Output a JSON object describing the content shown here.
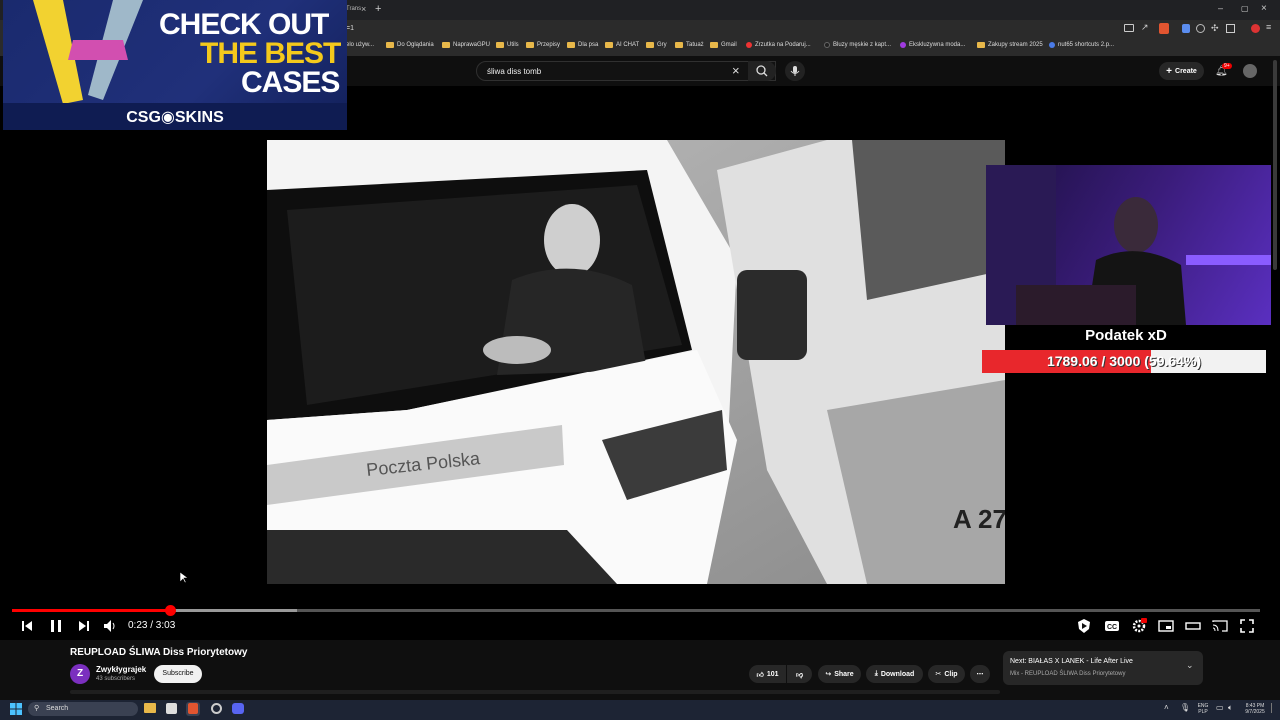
{
  "browser": {
    "tab_partial": "Trans",
    "url_partial": "=1",
    "bookmarks": [
      {
        "label": "elo używ...",
        "kind": "text"
      },
      {
        "label": "Do Oglądania",
        "kind": "folder"
      },
      {
        "label": "NaprawaGPU",
        "kind": "folder"
      },
      {
        "label": "Utils",
        "kind": "folder"
      },
      {
        "label": "Przepisy",
        "kind": "folder"
      },
      {
        "label": "Dla psa",
        "kind": "folder"
      },
      {
        "label": "AI CHAT",
        "kind": "folder"
      },
      {
        "label": "Gry",
        "kind": "folder"
      },
      {
        "label": "Tatuaż",
        "kind": "folder"
      },
      {
        "label": "Gmail",
        "kind": "folder"
      },
      {
        "label": "Zrzutka na Podaruj...",
        "kind": "site"
      },
      {
        "label": "Bluzy męskie z kapt...",
        "kind": "site"
      },
      {
        "label": "Ekskluzywna moda...",
        "kind": "site"
      },
      {
        "label": "Zakupy stream 2025",
        "kind": "folder"
      },
      {
        "label": "nut65 shortcuts 2.p...",
        "kind": "site"
      }
    ]
  },
  "youtube": {
    "search_value": "śliwa diss tomb",
    "create_label": "Create",
    "notif_badge": "9+"
  },
  "overlay_ad": {
    "line1": "CHECK OUT",
    "line2": "THE BEST",
    "line3": "CASES",
    "brand": "CSG◉SKINS"
  },
  "stream_overlay": {
    "label": "Podatek xD",
    "progress_text": "1789.06 / 3000 (59.64%)",
    "progress_fraction": 0.5964
  },
  "video": {
    "van_text": "Poczta Polska",
    "plate_partial": "A 27",
    "time_display": "0:23 / 3:03",
    "played_fraction": 0.127,
    "buffered_fraction": 0.228
  },
  "video_info": {
    "title": "REUPLOAD ŚLIWA Diss Priorytetowy",
    "channel": "Zwykłygrajek",
    "avatar_letter": "Z",
    "subscribers": "43 subscribers",
    "subscribe_label": "Subscribe",
    "likes": "101",
    "share_label": "Share",
    "download_label": "Download",
    "clip_label": "Clip"
  },
  "next_card": {
    "title": "Next: BIAŁAS X LANEK - Life After Live",
    "subtitle": "Mix - REUPLOAD ŚLIWA Diss Priorytetowy"
  },
  "taskbar": {
    "search_placeholder": "Search",
    "lang_top": "ENG",
    "lang_bottom": "PLP",
    "time": "8:43 PM",
    "date": "9/7/2025"
  }
}
